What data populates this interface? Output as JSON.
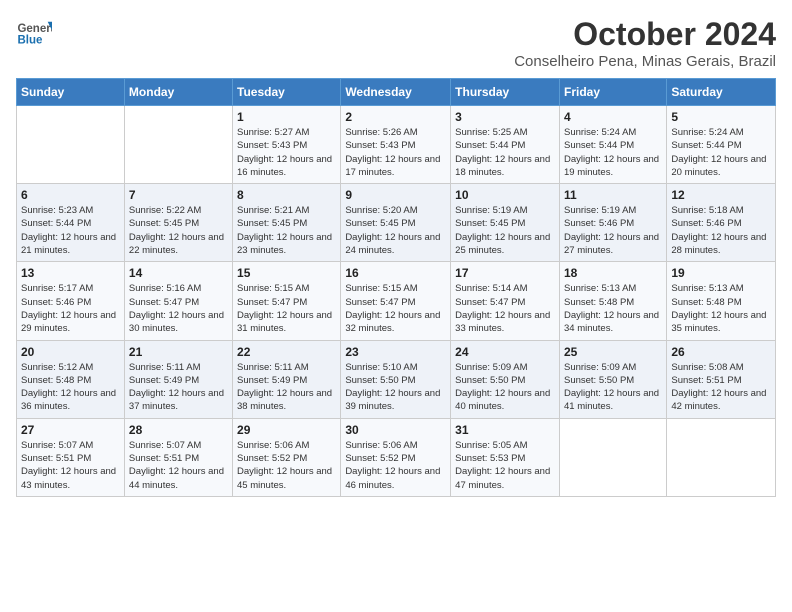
{
  "header": {
    "logo_line1": "General",
    "logo_line2": "Blue",
    "title": "October 2024",
    "location": "Conselheiro Pena, Minas Gerais, Brazil"
  },
  "weekdays": [
    "Sunday",
    "Monday",
    "Tuesday",
    "Wednesday",
    "Thursday",
    "Friday",
    "Saturday"
  ],
  "weeks": [
    [
      {
        "day": "",
        "info": ""
      },
      {
        "day": "",
        "info": ""
      },
      {
        "day": "1",
        "info": "Sunrise: 5:27 AM\nSunset: 5:43 PM\nDaylight: 12 hours and 16 minutes."
      },
      {
        "day": "2",
        "info": "Sunrise: 5:26 AM\nSunset: 5:43 PM\nDaylight: 12 hours and 17 minutes."
      },
      {
        "day": "3",
        "info": "Sunrise: 5:25 AM\nSunset: 5:44 PM\nDaylight: 12 hours and 18 minutes."
      },
      {
        "day": "4",
        "info": "Sunrise: 5:24 AM\nSunset: 5:44 PM\nDaylight: 12 hours and 19 minutes."
      },
      {
        "day": "5",
        "info": "Sunrise: 5:24 AM\nSunset: 5:44 PM\nDaylight: 12 hours and 20 minutes."
      }
    ],
    [
      {
        "day": "6",
        "info": "Sunrise: 5:23 AM\nSunset: 5:44 PM\nDaylight: 12 hours and 21 minutes."
      },
      {
        "day": "7",
        "info": "Sunrise: 5:22 AM\nSunset: 5:45 PM\nDaylight: 12 hours and 22 minutes."
      },
      {
        "day": "8",
        "info": "Sunrise: 5:21 AM\nSunset: 5:45 PM\nDaylight: 12 hours and 23 minutes."
      },
      {
        "day": "9",
        "info": "Sunrise: 5:20 AM\nSunset: 5:45 PM\nDaylight: 12 hours and 24 minutes."
      },
      {
        "day": "10",
        "info": "Sunrise: 5:19 AM\nSunset: 5:45 PM\nDaylight: 12 hours and 25 minutes."
      },
      {
        "day": "11",
        "info": "Sunrise: 5:19 AM\nSunset: 5:46 PM\nDaylight: 12 hours and 27 minutes."
      },
      {
        "day": "12",
        "info": "Sunrise: 5:18 AM\nSunset: 5:46 PM\nDaylight: 12 hours and 28 minutes."
      }
    ],
    [
      {
        "day": "13",
        "info": "Sunrise: 5:17 AM\nSunset: 5:46 PM\nDaylight: 12 hours and 29 minutes."
      },
      {
        "day": "14",
        "info": "Sunrise: 5:16 AM\nSunset: 5:47 PM\nDaylight: 12 hours and 30 minutes."
      },
      {
        "day": "15",
        "info": "Sunrise: 5:15 AM\nSunset: 5:47 PM\nDaylight: 12 hours and 31 minutes."
      },
      {
        "day": "16",
        "info": "Sunrise: 5:15 AM\nSunset: 5:47 PM\nDaylight: 12 hours and 32 minutes."
      },
      {
        "day": "17",
        "info": "Sunrise: 5:14 AM\nSunset: 5:47 PM\nDaylight: 12 hours and 33 minutes."
      },
      {
        "day": "18",
        "info": "Sunrise: 5:13 AM\nSunset: 5:48 PM\nDaylight: 12 hours and 34 minutes."
      },
      {
        "day": "19",
        "info": "Sunrise: 5:13 AM\nSunset: 5:48 PM\nDaylight: 12 hours and 35 minutes."
      }
    ],
    [
      {
        "day": "20",
        "info": "Sunrise: 5:12 AM\nSunset: 5:48 PM\nDaylight: 12 hours and 36 minutes."
      },
      {
        "day": "21",
        "info": "Sunrise: 5:11 AM\nSunset: 5:49 PM\nDaylight: 12 hours and 37 minutes."
      },
      {
        "day": "22",
        "info": "Sunrise: 5:11 AM\nSunset: 5:49 PM\nDaylight: 12 hours and 38 minutes."
      },
      {
        "day": "23",
        "info": "Sunrise: 5:10 AM\nSunset: 5:50 PM\nDaylight: 12 hours and 39 minutes."
      },
      {
        "day": "24",
        "info": "Sunrise: 5:09 AM\nSunset: 5:50 PM\nDaylight: 12 hours and 40 minutes."
      },
      {
        "day": "25",
        "info": "Sunrise: 5:09 AM\nSunset: 5:50 PM\nDaylight: 12 hours and 41 minutes."
      },
      {
        "day": "26",
        "info": "Sunrise: 5:08 AM\nSunset: 5:51 PM\nDaylight: 12 hours and 42 minutes."
      }
    ],
    [
      {
        "day": "27",
        "info": "Sunrise: 5:07 AM\nSunset: 5:51 PM\nDaylight: 12 hours and 43 minutes."
      },
      {
        "day": "28",
        "info": "Sunrise: 5:07 AM\nSunset: 5:51 PM\nDaylight: 12 hours and 44 minutes."
      },
      {
        "day": "29",
        "info": "Sunrise: 5:06 AM\nSunset: 5:52 PM\nDaylight: 12 hours and 45 minutes."
      },
      {
        "day": "30",
        "info": "Sunrise: 5:06 AM\nSunset: 5:52 PM\nDaylight: 12 hours and 46 minutes."
      },
      {
        "day": "31",
        "info": "Sunrise: 5:05 AM\nSunset: 5:53 PM\nDaylight: 12 hours and 47 minutes."
      },
      {
        "day": "",
        "info": ""
      },
      {
        "day": "",
        "info": ""
      }
    ]
  ]
}
